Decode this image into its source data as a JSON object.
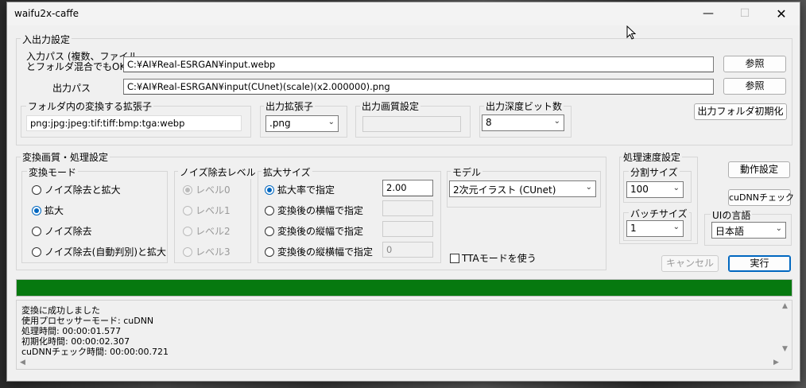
{
  "window": {
    "title": "waifu2x-caffe"
  },
  "io": {
    "legend": "入出力設定",
    "input_label": "入力パス (複数、ファイル\nとフォルダ混合でもOK)",
    "input_value": "C:¥AI¥Real-ESRGAN¥input.webp",
    "output_label": "出力パス",
    "output_value": "C:¥AI¥Real-ESRGAN¥input(CUnet)(scale)(x2.000000).png",
    "browse_label": "参照",
    "ext_legend": "フォルダ内の変換する拡張子",
    "ext_value": "png:jpg:jpeg:tif:tiff:bmp:tga:webp",
    "out_ext_legend": "出力拡張子",
    "out_ext_value": ".png",
    "quality_legend": "出力画質設定",
    "depth_legend": "出力深度ビット数",
    "depth_value": "8",
    "reset_folder_label": "出力フォルダ初期化"
  },
  "conv": {
    "legend": "変換画質・処理設定",
    "mode_legend": "変換モード",
    "modes": [
      "ノイズ除去と拡大",
      "拡大",
      "ノイズ除去",
      "ノイズ除去(自動判別)と拡大"
    ],
    "noise_legend": "ノイズ除去レベル",
    "noise_levels": [
      "レベル0",
      "レベル1",
      "レベル2",
      "レベル3"
    ],
    "scale_legend": "拡大サイズ",
    "scale_options": [
      "拡大率で指定",
      "変換後の横幅で指定",
      "変換後の縦幅で指定",
      "変換後の縦横幅で指定"
    ],
    "scale_ratio_value": "2.00",
    "scale_wh_value": "0",
    "model_legend": "モデル",
    "model_value": "2次元イラスト (CUnet)",
    "tta_label": "TTAモードを使う"
  },
  "speed": {
    "legend": "処理速度設定",
    "split_legend": "分割サイズ",
    "split_value": "100",
    "batch_legend": "バッチサイズ",
    "batch_value": "1"
  },
  "side": {
    "op_settings_label": "動作設定",
    "cudnn_check_label": "cuDNNチェック",
    "lang_legend": "UIの言語",
    "lang_value": "日本語",
    "cancel_label": "キャンセル",
    "run_label": "実行"
  },
  "progress": {
    "value": 1.0,
    "color": "#06790f"
  },
  "log": {
    "lines": [
      "変換に成功しました",
      "使用プロセッサーモード: cuDNN",
      "処理時間: 00:00:01.577",
      "初期化時間: 00:00:02.307",
      "cuDNNチェック時間: 00:00:00.721"
    ]
  }
}
